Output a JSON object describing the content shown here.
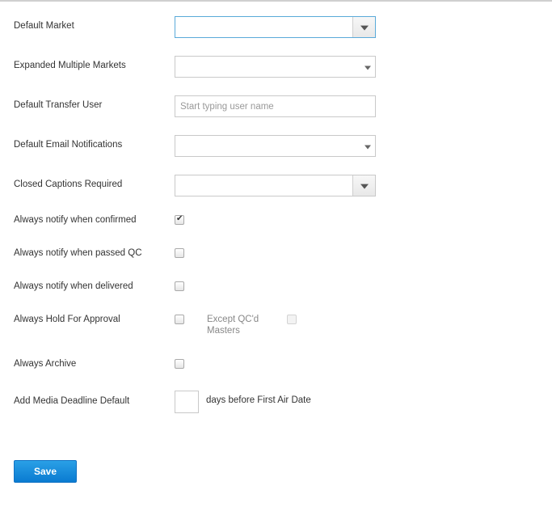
{
  "form": {
    "default_market": {
      "label": "Default Market",
      "value": "",
      "focused": true,
      "icon": "chevron-down-icon"
    },
    "expanded_multiple_markets": {
      "label": "Expanded Multiple Markets",
      "value": "",
      "icon": "chevron-down-icon"
    },
    "default_transfer_user": {
      "label": "Default Transfer User",
      "value": "",
      "placeholder": "Start typing user name"
    },
    "default_email_notifications": {
      "label": "Default Email Notifications",
      "value": "",
      "icon": "chevron-down-icon"
    },
    "closed_captions_required": {
      "label": "Closed Captions Required",
      "value": "",
      "icon": "chevron-down-icon"
    },
    "notify_confirmed": {
      "label": "Always notify when confirmed",
      "checked": true,
      "check_glyph": "✔"
    },
    "notify_passed_qc": {
      "label": "Always notify when passed QC",
      "checked": false
    },
    "notify_delivered": {
      "label": "Always notify when delivered",
      "checked": false
    },
    "hold_for_approval": {
      "label": "Always Hold For Approval",
      "checked": false,
      "except_label": "Except QC'd Masters",
      "except_checked": false,
      "except_disabled": true
    },
    "always_archive": {
      "label": "Always Archive",
      "checked": false
    },
    "media_deadline": {
      "label": "Add Media Deadline Default",
      "value": "",
      "suffix": "days before First Air Date"
    }
  },
  "actions": {
    "save_label": "Save"
  },
  "colors": {
    "accent": "#0a7bd1",
    "focus_border": "#5aaad9"
  }
}
